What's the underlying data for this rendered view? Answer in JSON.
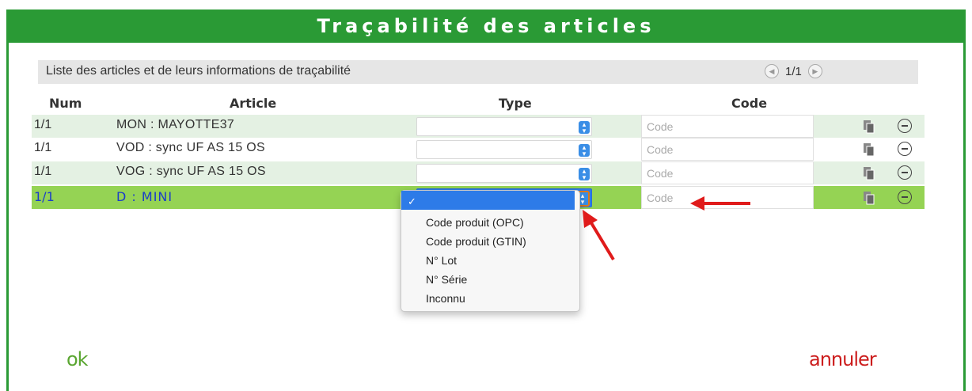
{
  "dialog": {
    "title": "Traçabilité des articles"
  },
  "list": {
    "header": "Liste des articles et de leurs informations de traçabilité",
    "page": "1/1"
  },
  "columns": {
    "num": "Num",
    "article": "Article",
    "type": "Type",
    "code": "Code"
  },
  "rows": [
    {
      "num": "1/1",
      "article": "MON : MAYOTTE37",
      "type": "",
      "code_placeholder": "Code"
    },
    {
      "num": "1/1",
      "article": "VOD : sync UF AS 15 OS",
      "type": "",
      "code_placeholder": "Code"
    },
    {
      "num": "1/1",
      "article": "VOG : sync UF AS 15 OS",
      "type": "",
      "code_placeholder": "Code"
    },
    {
      "num": "1/1",
      "article": "D : MINI",
      "type": "",
      "code_placeholder": "Code"
    }
  ],
  "type_dropdown": {
    "selected_mark": "✓",
    "options": [
      "Code produit (OPC)",
      "Code produit (GTIN)",
      "N° Lot",
      "N° Série",
      "Inconnu"
    ]
  },
  "actions": {
    "ok": "ok",
    "cancel": "annuler"
  },
  "colors": {
    "title_bg": "#2a9a35",
    "row_alt": "#e4f1e3",
    "row_selected": "#95d354",
    "ok": "#5aa631",
    "cancel": "#cc1d1d",
    "annotation_arrow": "#e01b1b"
  }
}
